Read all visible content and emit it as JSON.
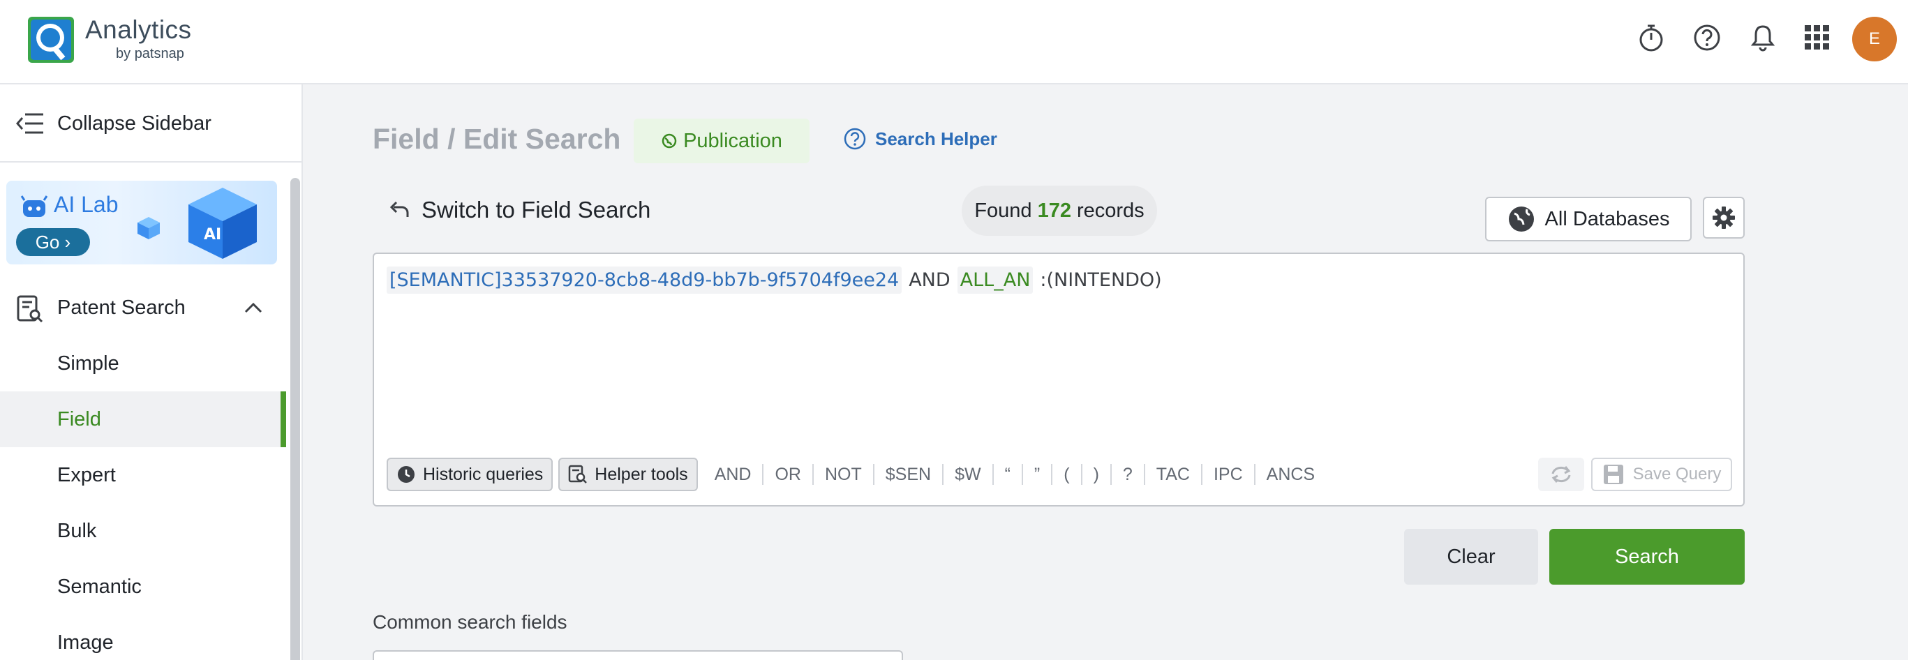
{
  "header": {
    "brand": "Analytics",
    "brand_by": "by",
    "brand_company": "patsnap",
    "avatar_initial": "E",
    "icons": [
      "timer-icon",
      "help-icon",
      "bell-icon",
      "apps-grid-icon"
    ]
  },
  "sidebar": {
    "collapse_label": "Collapse Sidebar",
    "ailab": {
      "title": "AI Lab",
      "go_label": "Go ›",
      "cube_text": "AI"
    },
    "section": {
      "label": "Patent Search"
    },
    "items": [
      {
        "label": "Simple",
        "active": false
      },
      {
        "label": "Field",
        "active": true
      },
      {
        "label": "Expert",
        "active": false
      },
      {
        "label": "Bulk",
        "active": false
      },
      {
        "label": "Semantic",
        "active": false
      },
      {
        "label": "Image",
        "active": false
      }
    ]
  },
  "main": {
    "title": "Field / Edit Search",
    "badge": "Publication",
    "search_helper": "Search Helper",
    "switch_label": "Switch to Field Search",
    "found": {
      "prefix": "Found",
      "count": "172",
      "suffix": "records"
    },
    "all_databases": "All Databases",
    "query": {
      "semantic_token": "[SEMANTIC]33537920-8cb8-48d9-bb7b-9f5704f9ee24",
      "operator": "AND",
      "field_token": "ALL_AN",
      "value": ":(NINTENDO)"
    },
    "tools": {
      "historic": "Historic queries",
      "helper": "Helper tools",
      "operators": [
        "AND",
        "OR",
        "NOT",
        "$SEN",
        "$W",
        "“",
        "”",
        "(",
        ")",
        "?",
        "TAC",
        "IPC",
        "ANCS"
      ],
      "save_query": "Save Query"
    },
    "clear_label": "Clear",
    "search_label": "Search",
    "common_fields": "Common search fields"
  },
  "colors": {
    "accent_green": "#4b9b2c",
    "link_blue": "#2d6db8",
    "avatar": "#d8772a"
  }
}
